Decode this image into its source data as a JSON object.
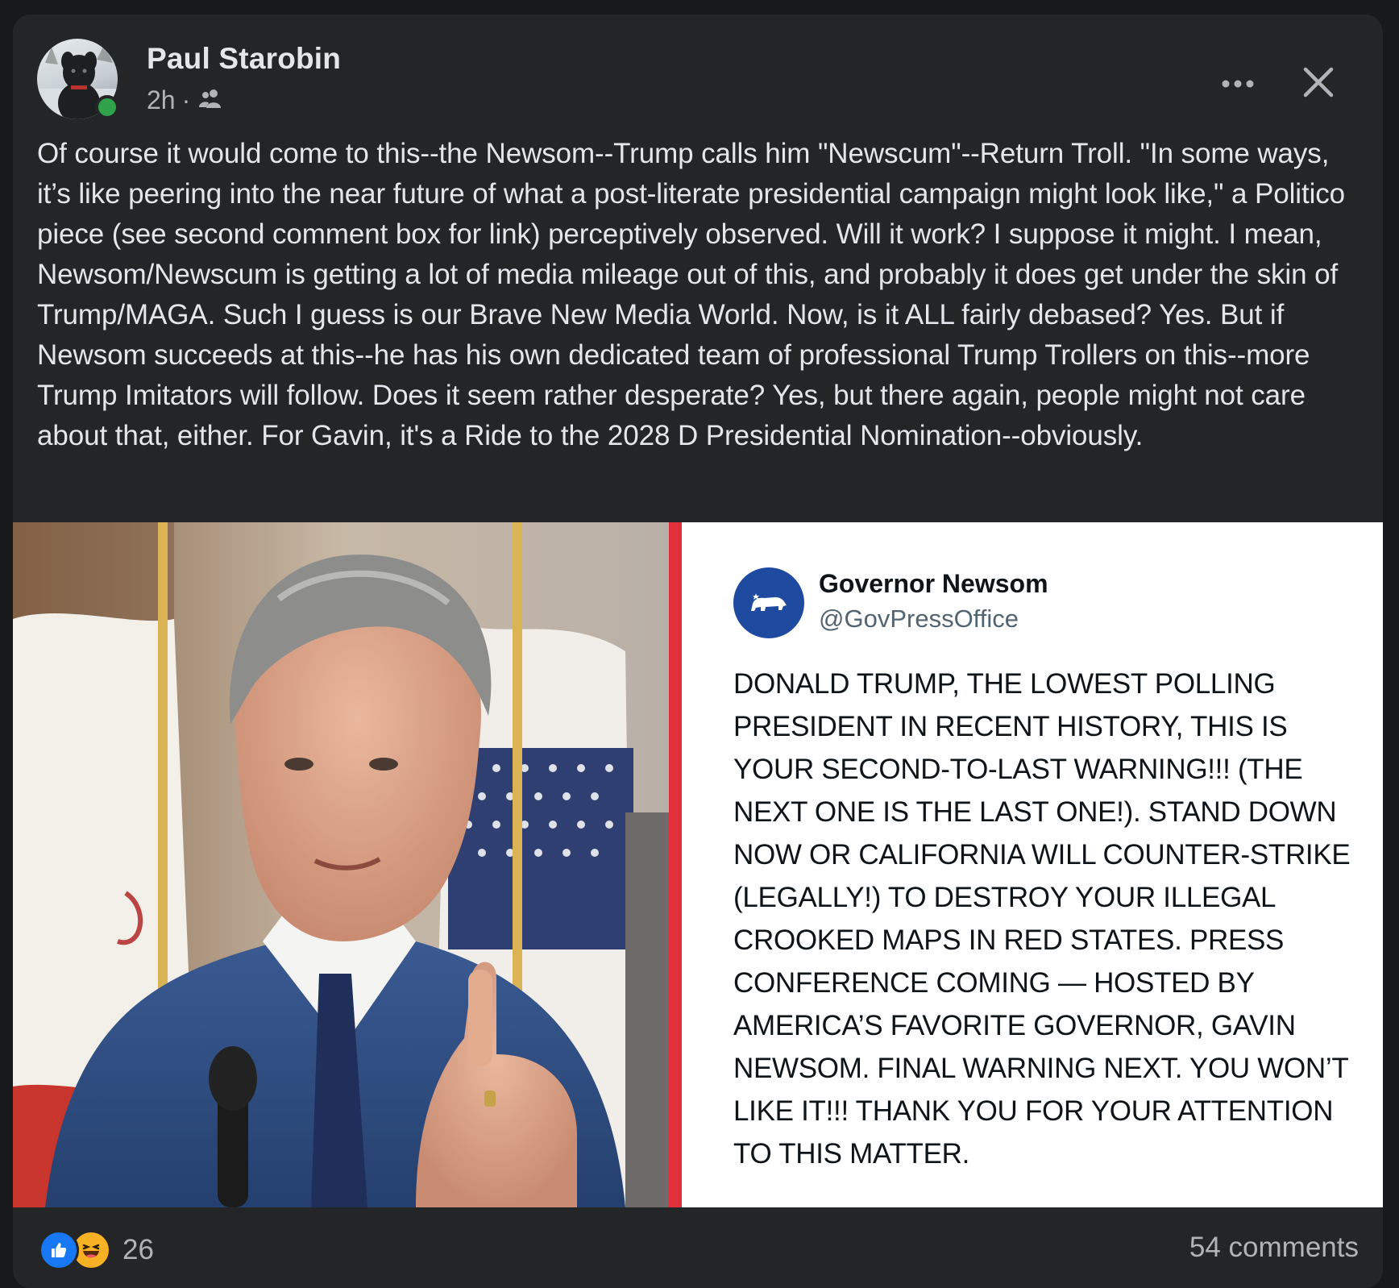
{
  "post": {
    "author": "Paul Starobin",
    "time": "2h",
    "separator": "·",
    "audience_icon": "friends-icon",
    "text": "Of course it would come to this--the Newsom--Trump calls him \"Newscum\"--Return Troll. \"In some ways, it’s like peering into the near future of what a post-literate presidential campaign might look like,\" a Politico piece (see second comment box for link) perceptively observed. Will it work? I suppose it might. I mean, Newsom/Newscum is getting a lot of media mileage out of this, and probably it does get under the skin of Trump/MAGA. Such I guess is our Brave New Media World. Now, is it ALL fairly debased? Yes. But if Newsom succeeds at this--he has his own dedicated team of professional Trump Trollers on this--more Trump Imitators will follow. Does it seem rather desperate? Yes, but there again, people might not care about that, either. For Gavin, it's a Ride to the 2028 D Presidential Nomination--obviously."
  },
  "tweet": {
    "name": "Governor Newsom",
    "handle": "@GovPressOffice",
    "body": "DONALD TRUMP, THE LOWEST POLLING PRESIDENT IN RECENT HISTORY, THIS IS YOUR SECOND-TO-LAST WARNING!!! (THE NEXT ONE IS THE LAST ONE!). STAND DOWN NOW OR CALIFORNIA WILL COUNTER-STRIKE (LEGALLY!) TO DESTROY YOUR ILLEGAL CROOKED MAPS IN RED STATES. PRESS CONFERENCE COMING — HOSTED BY AMERICA’S FAVORITE GOVERNOR, GAVIN NEWSOM. FINAL WARNING NEXT. YOU WON’T LIKE IT!!! THANK YOU FOR YOUR ATTENTION TO THIS MATTER."
  },
  "footer": {
    "reaction_count": "26",
    "comments": "54 comments"
  },
  "colors": {
    "card_bg": "#242526",
    "text_primary": "#e4e6eb",
    "text_secondary": "#b0b3b8",
    "online_green": "#31a24c",
    "like_blue": "#1877f2",
    "divider_red": "#e0313b",
    "seal_blue": "#1e4ba0"
  }
}
